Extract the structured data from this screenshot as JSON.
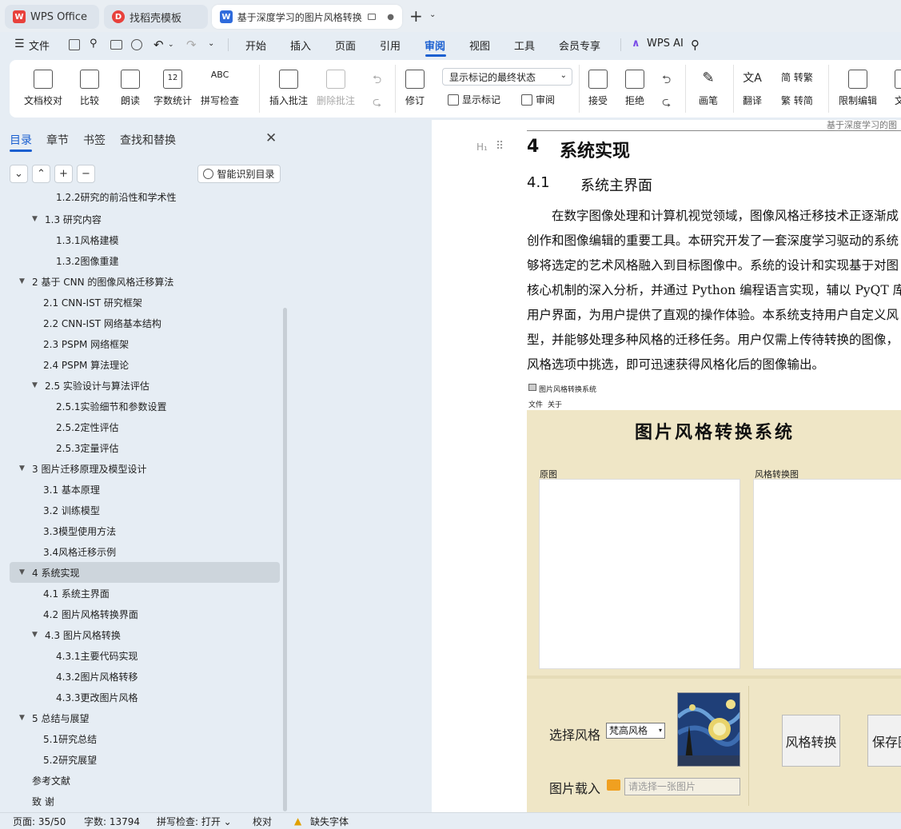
{
  "tabs": [
    {
      "label": "WPS Office",
      "icon": "wps-logo-icon"
    },
    {
      "label": "找稻壳模板",
      "icon": "docer-icon"
    },
    {
      "label": "基于深度学习的图片风格转换系",
      "icon": "writer-doc-icon"
    }
  ],
  "menus": [
    "文件",
    "开始",
    "插入",
    "页面",
    "引用",
    "审阅",
    "视图",
    "工具",
    "会员专享",
    "WPS AI"
  ],
  "ribbon": {
    "doc_check": "文档校对",
    "compare": "比较",
    "read": "朗读",
    "word_count": "字数统计",
    "spell": "拼写检查",
    "insert_comment": "插入批注",
    "delete_comment": "删除批注",
    "revise": "修订",
    "markup_mode": "显示标记的最终状态",
    "show_markup": "显示标记",
    "review": "审阅",
    "accept": "接受",
    "reject": "拒绝",
    "pen": "画笔",
    "translate": "翻译",
    "to_traditional": "简 转繁",
    "to_simplified": "繁 转简",
    "restrict": "限制编辑",
    "doc_more": "文档"
  },
  "sidebar": {
    "tabs": [
      "目录",
      "章节",
      "书签",
      "查找和替换"
    ],
    "smart_toc": "智能识别目录",
    "toc": [
      {
        "label": "1.2.2研究的前沿性和学术性",
        "level": 3,
        "arrow": ""
      },
      {
        "label": "1.3  研究内容",
        "level": 2,
        "arrow": "▼"
      },
      {
        "label": "1.3.1风格建模",
        "level": 3,
        "arrow": ""
      },
      {
        "label": "1.3.2图像重建",
        "level": 3,
        "arrow": ""
      },
      {
        "label": "2  基于 CNN 的图像风格迁移算法",
        "level": 1,
        "arrow": "▼"
      },
      {
        "label": "2.1  CNN-IST 研究框架",
        "level": 2,
        "arrow": ""
      },
      {
        "label": "2.2  CNN-IST 网络基本结构",
        "level": 2,
        "arrow": ""
      },
      {
        "label": "2.3  PSPM  网络框架",
        "level": 2,
        "arrow": ""
      },
      {
        "label": "2.4  PSPM 算法理论",
        "level": 2,
        "arrow": ""
      },
      {
        "label": "2.5  实验设计与算法评估",
        "level": 2,
        "arrow": "▼"
      },
      {
        "label": "2.5.1实验细节和参数设置",
        "level": 3,
        "arrow": ""
      },
      {
        "label": "2.5.2定性评估",
        "level": 3,
        "arrow": ""
      },
      {
        "label": "2.5.3定量评估",
        "level": 3,
        "arrow": ""
      },
      {
        "label": "3  图片迁移原理及模型设计",
        "level": 1,
        "arrow": "▼"
      },
      {
        "label": "3.1  基本原理",
        "level": 2,
        "arrow": ""
      },
      {
        "label": "3.2  训练模型",
        "level": 2,
        "arrow": ""
      },
      {
        "label": "3.3模型使用方法",
        "level": 2,
        "arrow": ""
      },
      {
        "label": "3.4风格迁移示例",
        "level": 2,
        "arrow": ""
      },
      {
        "label": "4  系统实现",
        "level": 1,
        "arrow": "▼"
      },
      {
        "label": "4.1  系统主界面",
        "level": 2,
        "arrow": ""
      },
      {
        "label": "4.2  图片风格转换界面",
        "level": 2,
        "arrow": ""
      },
      {
        "label": "4.3  图片风格转换",
        "level": 2,
        "arrow": "▼"
      },
      {
        "label": "4.3.1主要代码实现",
        "level": 3,
        "arrow": ""
      },
      {
        "label": "4.3.2图片风格转移",
        "level": 3,
        "arrow": ""
      },
      {
        "label": "4.3.3更改图片风格",
        "level": 3,
        "arrow": ""
      },
      {
        "label": "5  总结与展望",
        "level": 1,
        "arrow": "▼"
      },
      {
        "label": "5.1研究总结",
        "level": 2,
        "arrow": ""
      },
      {
        "label": "5.2研究展望",
        "level": 2,
        "arrow": ""
      },
      {
        "label": "参考文献",
        "level": 1,
        "arrow": ""
      },
      {
        "label": "致  谢",
        "level": 1,
        "arrow": ""
      }
    ]
  },
  "doc": {
    "header_text": "基于深度学习的图",
    "heading_marker": "H₁",
    "chapter_num": "4",
    "chapter_title": "系统实现",
    "section_num": "4.1",
    "section_title": "系统主界面",
    "para": [
      "在数字图像处理和计算机视觉领域，图像风格迁移技术正逐渐成",
      "创作和图像编辑的重要工具。本研究开发了一套深度学习驱动的系统",
      "够将选定的艺术风格融入到目标图像中。系统的设计和实现基于对图",
      "核心机制的深入分析，并通过 Python 编程语言实现，辅以 PyQT 库",
      "用户界面，为用户提供了直观的操作体验。本系统支持用户自定义风",
      "型，并能够处理多种风格的迁移任务。用户仅需上传待转换的图像，",
      "风格选项中挑选，即可迅速获得风格化后的图像输出。"
    ],
    "app": {
      "window_title": "图片风格转换系统",
      "menu_file": "文件",
      "menu_about": "关于",
      "title": "图片风格转换系统",
      "original_label": "原图",
      "styled_label": "风格转换图",
      "choose_style": "选择风格",
      "style_value": "梵高风格",
      "load_image": "图片载入",
      "load_placeholder": "请选择一张图片",
      "convert_btn": "风格转换",
      "save_btn": "保存图"
    }
  },
  "status": {
    "page": "页面: 35/50",
    "words": "字数: 13794",
    "spell": "拼写检查: 打开",
    "proof": "校对",
    "missing_font": "缺失字体"
  },
  "colors": {
    "accent": "#1a5fd0",
    "wps_red": "#e8413c",
    "app_bg": "#efe6c6"
  }
}
